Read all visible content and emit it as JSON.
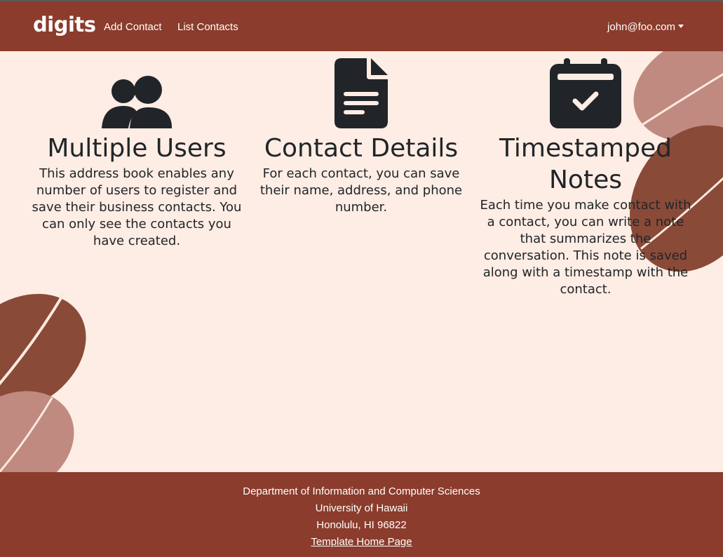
{
  "nav": {
    "brand": "digits",
    "links": [
      {
        "label": "Add Contact"
      },
      {
        "label": "List Contacts"
      }
    ],
    "user": "john@foo.com"
  },
  "features": [
    {
      "icon": "users-icon",
      "title": "Multiple Users",
      "text": "This address book enables any number of users to register and save their business contacts. You can only see the contacts you have created."
    },
    {
      "icon": "file-lines-icon",
      "title": "Contact Details",
      "text": "For each contact, you can save their name, address, and phone number."
    },
    {
      "icon": "calendar-check-icon",
      "title": "Timestamped Notes",
      "text": "Each time you make contact with a contact, you can write a note that summarizes the conversation. This note is saved along with a timestamp with the contact."
    }
  ],
  "footer": {
    "lines": [
      "Department of Information and Computer Sciences",
      "University of Hawaii",
      "Honolulu, HI 96822"
    ],
    "link": "Template Home Page"
  },
  "colors": {
    "primary": "#8b3c2c",
    "background": "#fdede4",
    "text": "#212529",
    "bean_dark": "#8a4a38",
    "bean_light": "#c08a80"
  }
}
